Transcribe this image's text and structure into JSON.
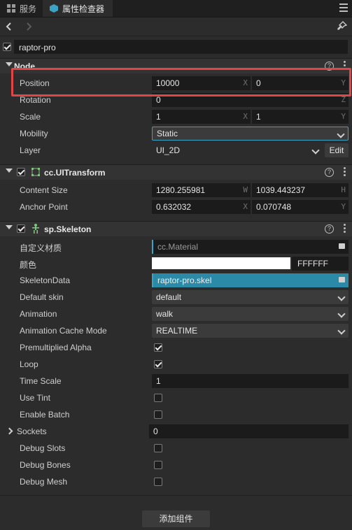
{
  "tabs": [
    {
      "label": "服务",
      "icon": "grid-icon"
    },
    {
      "label": "属性检查器",
      "icon": "inspector-icon"
    }
  ],
  "node_name": "raptor-pro",
  "node": {
    "title": "Node",
    "position": {
      "label": "Position",
      "x": "10000",
      "y": "0"
    },
    "rotation": {
      "label": "Rotation",
      "z": "0"
    },
    "scale": {
      "label": "Scale",
      "x": "1",
      "y": "1"
    },
    "mobility": {
      "label": "Mobility",
      "value": "Static"
    },
    "layer": {
      "label": "Layer",
      "value": "UI_2D",
      "edit": "Edit"
    }
  },
  "uitransform": {
    "title": "cc.UITransform",
    "content_size": {
      "label": "Content Size",
      "w": "1280.255981",
      "h": "1039.443237"
    },
    "anchor": {
      "label": "Anchor Point",
      "x": "0.632032",
      "y": "0.070748"
    }
  },
  "skeleton": {
    "title": "sp.Skeleton",
    "custom_material": {
      "label": "自定义材质",
      "value": "cc.Material"
    },
    "color": {
      "label": "颜色",
      "hex": "FFFFFF",
      "swatch": "#ffffff"
    },
    "skeleton_data": {
      "label": "SkeletonData",
      "value": "raptor-pro.skel"
    },
    "default_skin": {
      "label": "Default skin",
      "value": "default"
    },
    "animation": {
      "label": "Animation",
      "value": "walk"
    },
    "cache_mode": {
      "label": "Animation Cache Mode",
      "value": "REALTIME"
    },
    "premultiplied": {
      "label": "Premultiplied Alpha",
      "checked": true
    },
    "loop": {
      "label": "Loop",
      "checked": true
    },
    "time_scale": {
      "label": "Time Scale",
      "value": "1"
    },
    "use_tint": {
      "label": "Use Tint",
      "checked": false
    },
    "enable_batch": {
      "label": "Enable Batch",
      "checked": false
    },
    "sockets": {
      "label": "Sockets",
      "value": "0"
    },
    "debug_slots": {
      "label": "Debug Slots",
      "checked": false
    },
    "debug_bones": {
      "label": "Debug Bones",
      "checked": false
    },
    "debug_mesh": {
      "label": "Debug Mesh",
      "checked": false
    }
  },
  "axis": {
    "x": "X",
    "y": "Y",
    "z": "Z",
    "w": "W",
    "h": "H"
  },
  "help_glyph": "?",
  "add_component": "添加组件",
  "colors": {
    "accent": "#3ba4c4",
    "highlight": "#e04646",
    "background": "#2c2c2c"
  }
}
